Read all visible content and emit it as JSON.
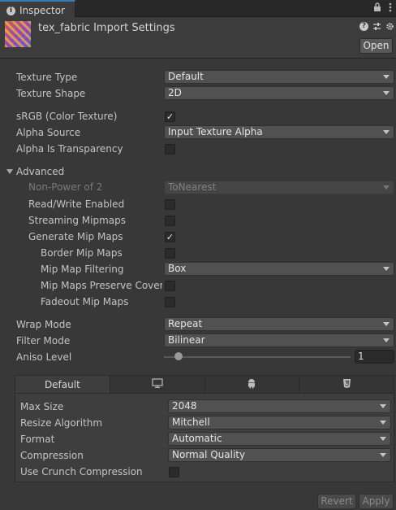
{
  "window": {
    "tab_label": "Inspector",
    "tab_info_glyph": "i",
    "tab_icons": [
      "lock-icon",
      "kebab-menu-icon"
    ]
  },
  "header": {
    "title": "tex_fabric Import Settings",
    "help_glyph": "?",
    "open_label": "Open"
  },
  "settings": {
    "texture_type": {
      "label": "Texture Type",
      "value": "Default"
    },
    "texture_shape": {
      "label": "Texture Shape",
      "value": "2D"
    },
    "srgb": {
      "label": "sRGB (Color Texture)",
      "checked": true
    },
    "alpha_source": {
      "label": "Alpha Source",
      "value": "Input Texture Alpha"
    },
    "alpha_is_transparency": {
      "label": "Alpha Is Transparency",
      "checked": false
    }
  },
  "advanced": {
    "label": "Advanced",
    "non_power_of_2": {
      "label": "Non-Power of 2",
      "value": "ToNearest"
    },
    "read_write": {
      "label": "Read/Write Enabled",
      "checked": false
    },
    "streaming_mipmaps": {
      "label": "Streaming Mipmaps",
      "checked": false
    },
    "generate_mip_maps": {
      "label": "Generate Mip Maps",
      "checked": true
    },
    "border_mip_maps": {
      "label": "Border Mip Maps",
      "checked": false
    },
    "mip_map_filtering": {
      "label": "Mip Map Filtering",
      "value": "Box"
    },
    "mip_maps_preserve_coverage": {
      "label": "Mip Maps Preserve Coverage",
      "checked": false
    },
    "fadeout_mip_maps": {
      "label": "Fadeout Mip Maps",
      "checked": false
    }
  },
  "sampling": {
    "wrap_mode": {
      "label": "Wrap Mode",
      "value": "Repeat"
    },
    "filter_mode": {
      "label": "Filter Mode",
      "value": "Bilinear"
    },
    "aniso_level": {
      "label": "Aniso Level",
      "value": "1",
      "slider_fraction": 0.0
    }
  },
  "platform": {
    "tabs": [
      {
        "name": "Default",
        "icon": ""
      },
      {
        "name": "",
        "icon": "monitor-icon"
      },
      {
        "name": "",
        "icon": "android-icon"
      },
      {
        "name": "",
        "icon": "html5-icon"
      }
    ],
    "max_size": {
      "label": "Max Size",
      "value": "2048"
    },
    "resize_algorithm": {
      "label": "Resize Algorithm",
      "value": "Mitchell"
    },
    "format": {
      "label": "Format",
      "value": "Automatic"
    },
    "compression": {
      "label": "Compression",
      "value": "Normal Quality"
    },
    "use_crunch": {
      "label": "Use Crunch Compression",
      "checked": false
    }
  },
  "footer": {
    "revert_label": "Revert",
    "apply_label": "Apply"
  },
  "check_glyph": "✓"
}
